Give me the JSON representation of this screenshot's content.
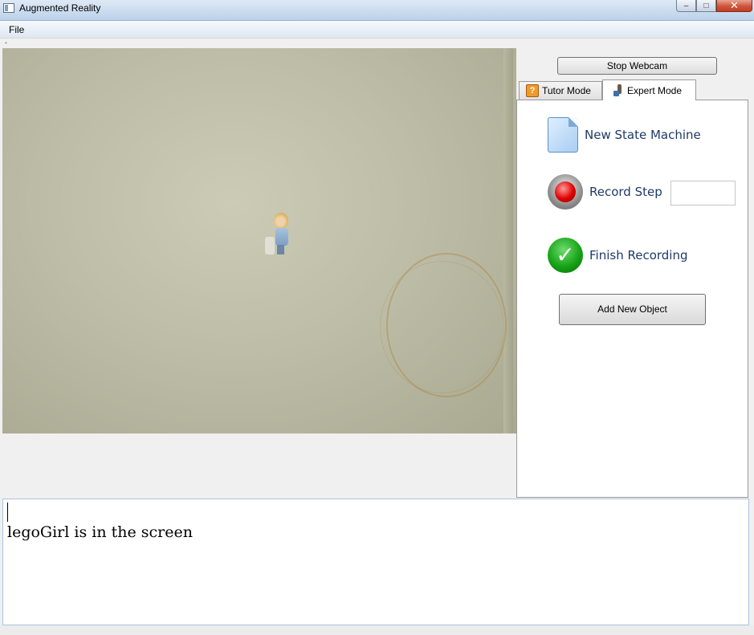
{
  "window": {
    "title": "Augmented Reality",
    "controls": {
      "minimize": "–",
      "maximize": "□",
      "close": "✕"
    }
  },
  "menu": {
    "file": "File"
  },
  "webcam_controls": {
    "stop_label": "Stop Webcam"
  },
  "tabs": [
    {
      "label": "Tutor Mode",
      "icon": "help-question-icon",
      "active": false
    },
    {
      "label": "Expert Mode",
      "icon": "expert-tool-icon",
      "active": true
    }
  ],
  "expert_mode": {
    "new_state_machine": "New State Machine",
    "record_step": "Record Step",
    "record_step_value": "",
    "finish_recording": "Finish Recording",
    "finish_icon_glyph": "✓",
    "add_new_object": "Add New Object"
  },
  "console": {
    "message": "legoGirl is in the screen"
  },
  "colors": {
    "action_text": "#1f3b66",
    "record_red": "#e00000",
    "finish_green": "#16a316"
  }
}
